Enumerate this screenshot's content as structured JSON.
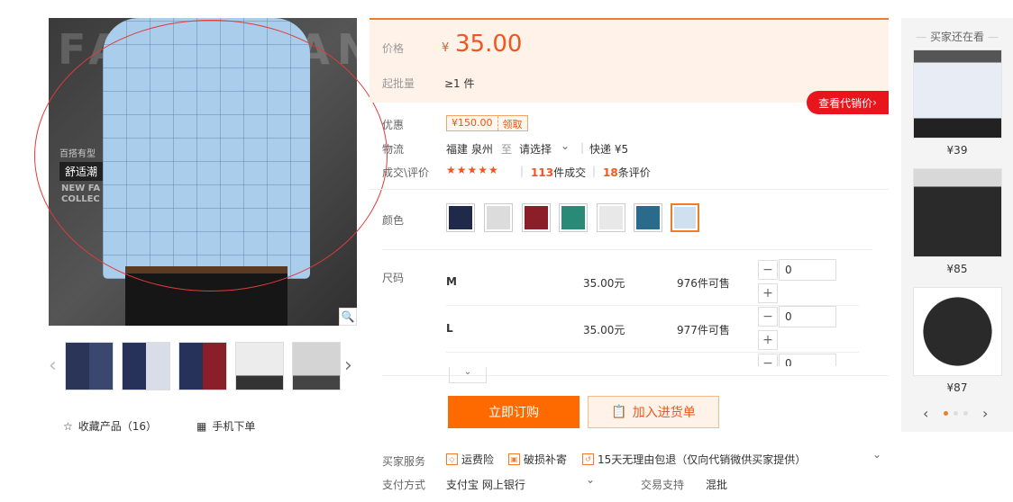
{
  "gallery": {
    "watermark": "FASHOMAN",
    "tag_small": "百搭有型",
    "tag_main": "舒适潮",
    "tag_en": "NEW FA COLLEC",
    "zoom_icon": "magnifier-icon",
    "thumbnails": [
      "navy-plaid",
      "navy-plaid-2",
      "navy-burgundy",
      "white-shirt",
      "white-shirt-2"
    ],
    "favorite_label": "收藏产品（16）",
    "mobile_label": "手机下单"
  },
  "price_panel": {
    "price_label": "价格",
    "currency": "¥",
    "price": "35.00",
    "moq_label": "起批量",
    "moq_value": "≥1 件",
    "agent_button": "查看代销价"
  },
  "details": {
    "promo_label": "优惠",
    "coupon_amount": "¥150.00",
    "coupon_action": "领取",
    "logistics_label": "物流",
    "origin": "福建 泉州",
    "to": "至",
    "destination": "请选择",
    "shipping": "快递 ¥5",
    "deals_label": "成交\\评价",
    "stars": "★★★★★",
    "deals_count": "113",
    "deals_suffix": "件成交",
    "reviews_count": "18",
    "reviews_suffix": "条评价",
    "color_label": "颜色",
    "size_label": "尺码"
  },
  "colors": [
    "#1f2a4a",
    "#dcdcdc",
    "#8a1f2a",
    "#2a8a78",
    "#e8e8e8",
    "#2a6a8a",
    "#cfe0f0"
  ],
  "sizes": [
    {
      "name": "M",
      "price": "35.00元",
      "stock": "976件可售",
      "qty": "0"
    },
    {
      "name": "L",
      "price": "35.00元",
      "stock": "977件可售",
      "qty": "0"
    }
  ],
  "actions": {
    "buy_now": "立即订购",
    "add_cart": "加入进货单"
  },
  "services": {
    "label": "买家服务",
    "items": [
      "运费险",
      "破损补寄",
      "15天无理由包退（仅向代销微供买家提供）"
    ],
    "pay_label": "支付方式",
    "pay_methods": "支付宝  网上银行",
    "trade_label": "交易支持",
    "trade_value": "混批"
  },
  "sidebar": {
    "title": "买家还在看",
    "items": [
      {
        "price": "¥39",
        "color": "#dfe4ee"
      },
      {
        "price": "¥85",
        "color": "#2a2a2a"
      },
      {
        "price": "¥87",
        "color": "#1c1c1c"
      }
    ]
  }
}
